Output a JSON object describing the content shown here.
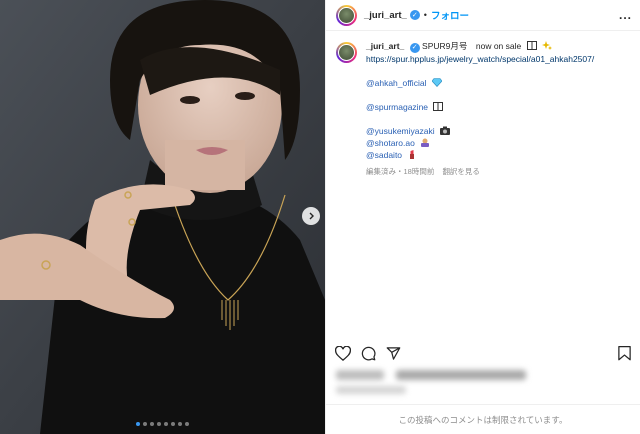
{
  "post": {
    "username": "_juri_art_",
    "separator": "•",
    "follow_label": "フォロー",
    "more_label": "...",
    "caption": {
      "username": "_juri_art_",
      "line1": "SPUR9月号　now on sale",
      "url": "https://spur.hpplus.jp/jewelry_watch/special/a01_ahkah2507/",
      "mention1": "@ahkah_official",
      "mention2": "@spurmagazine",
      "mention3": "@yusukemiyazaki",
      "mention4": "@shotaro.ao",
      "mention5": "@sadaito"
    },
    "meta": {
      "edited": "編集済み・18時間前",
      "translate": "翻訳を見る"
    },
    "comments_off": "この投稿へのコメントは制限されています。"
  },
  "carousel": {
    "count": 8,
    "active": 0
  },
  "colors": {
    "accent": "#0095f6",
    "verified": "#3897f0",
    "mention": "#2b61b4"
  },
  "icons": [
    "verified-icon",
    "heart-icon",
    "comment-icon",
    "share-icon",
    "bookmark-icon",
    "chevron-right-icon",
    "more-icon"
  ]
}
